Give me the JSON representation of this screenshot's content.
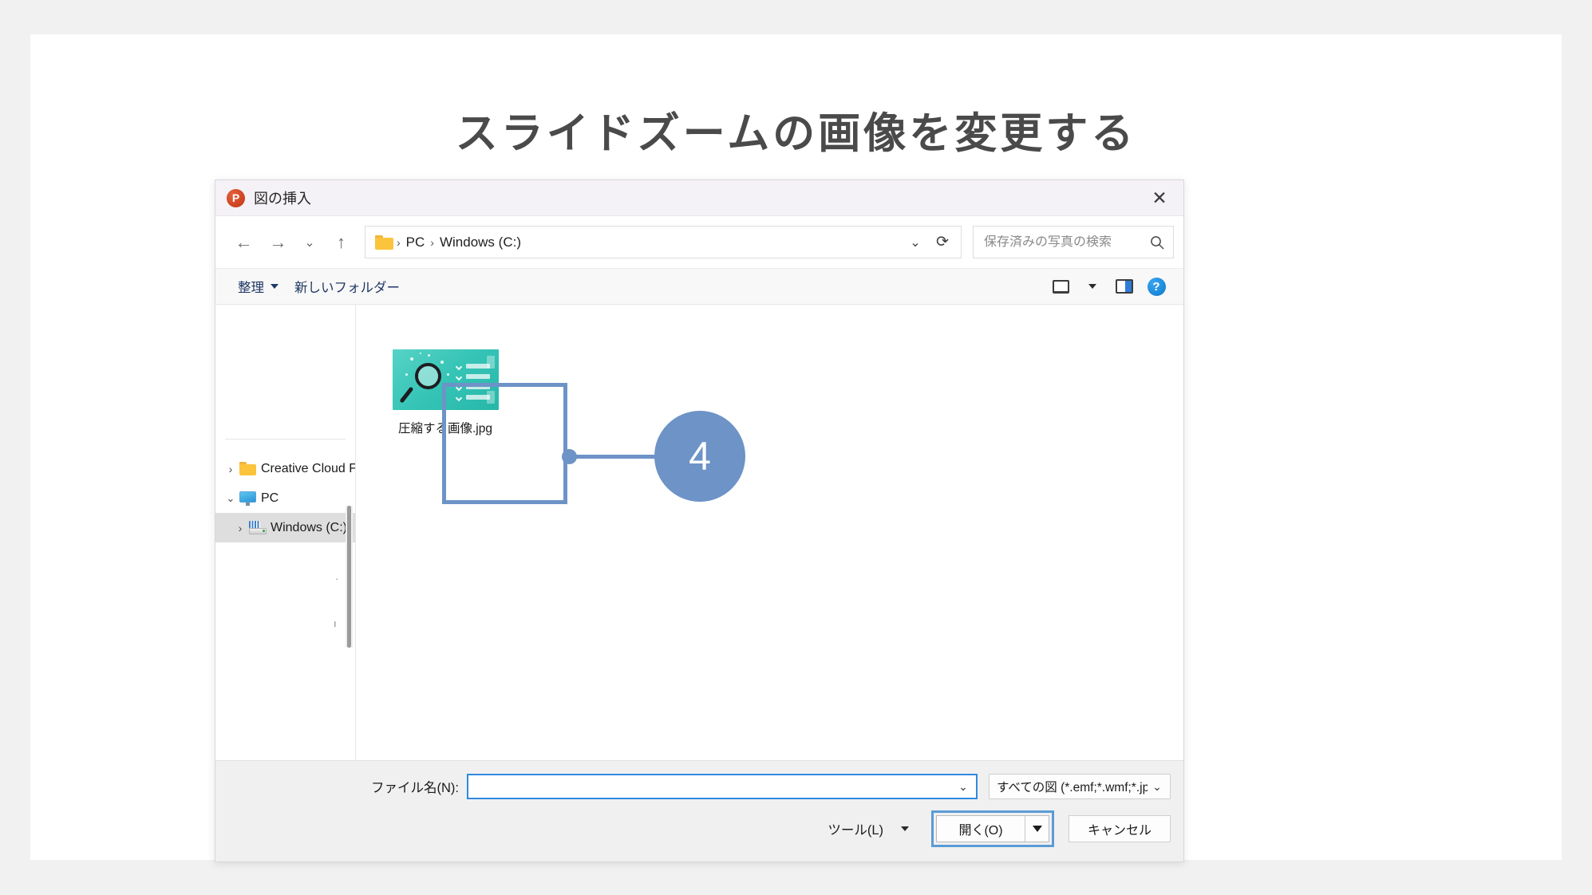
{
  "slide": {
    "title": "スライドズームの画像を変更する"
  },
  "dialog": {
    "app_icon": "powerpoint-icon",
    "title": "図の挿入",
    "close_label": "✕",
    "nav": {
      "back": "←",
      "forward": "→",
      "recent": "⌄",
      "up": "↑",
      "folder_icon": "folder-icon",
      "breadcrumbs": [
        "PC",
        "Windows (C:)"
      ],
      "separator": "›",
      "address_chevron": "⌄",
      "refresh": "⟳"
    },
    "search": {
      "placeholder": "保存済みの写真の検索",
      "value": "",
      "icon": "search-icon"
    },
    "toolbar": {
      "organize_label": "整理",
      "new_folder_label": "新しいフォルダー",
      "view_icon": "view-layout-icon",
      "view_chevron": "⌄",
      "preview_pane_icon": "preview-pane-icon",
      "help_icon": "?"
    },
    "sidebar": {
      "items": [
        {
          "label": "Creative Cloud F",
          "icon": "folder-icon",
          "twisty": "›",
          "expanded": false,
          "selected": false,
          "indent": false
        },
        {
          "label": "PC",
          "icon": "pc-icon",
          "twisty": "⌄",
          "expanded": true,
          "selected": false,
          "indent": false
        },
        {
          "label": "Windows (C:)",
          "icon": "drive-icon",
          "twisty": "›",
          "expanded": false,
          "selected": true,
          "indent": true
        }
      ]
    },
    "files": [
      {
        "name": "圧縮する画像.jpg",
        "selected": true,
        "thumbnail": "magnifier-checklist-thumbnail"
      }
    ],
    "footer": {
      "filename_label": "ファイル名(N):",
      "filename_value": "",
      "filename_chevron": "⌄",
      "filetype_value": "すべての図 (*.emf;*.wmf;*.jpg;*.j|",
      "filetype_chevron": "⌄",
      "tools_label": "ツール(L)",
      "open_label": "開く(O)",
      "cancel_label": "キャンセル"
    }
  },
  "annotation": {
    "step_number": "4",
    "accent_color": "#6d93c7"
  }
}
